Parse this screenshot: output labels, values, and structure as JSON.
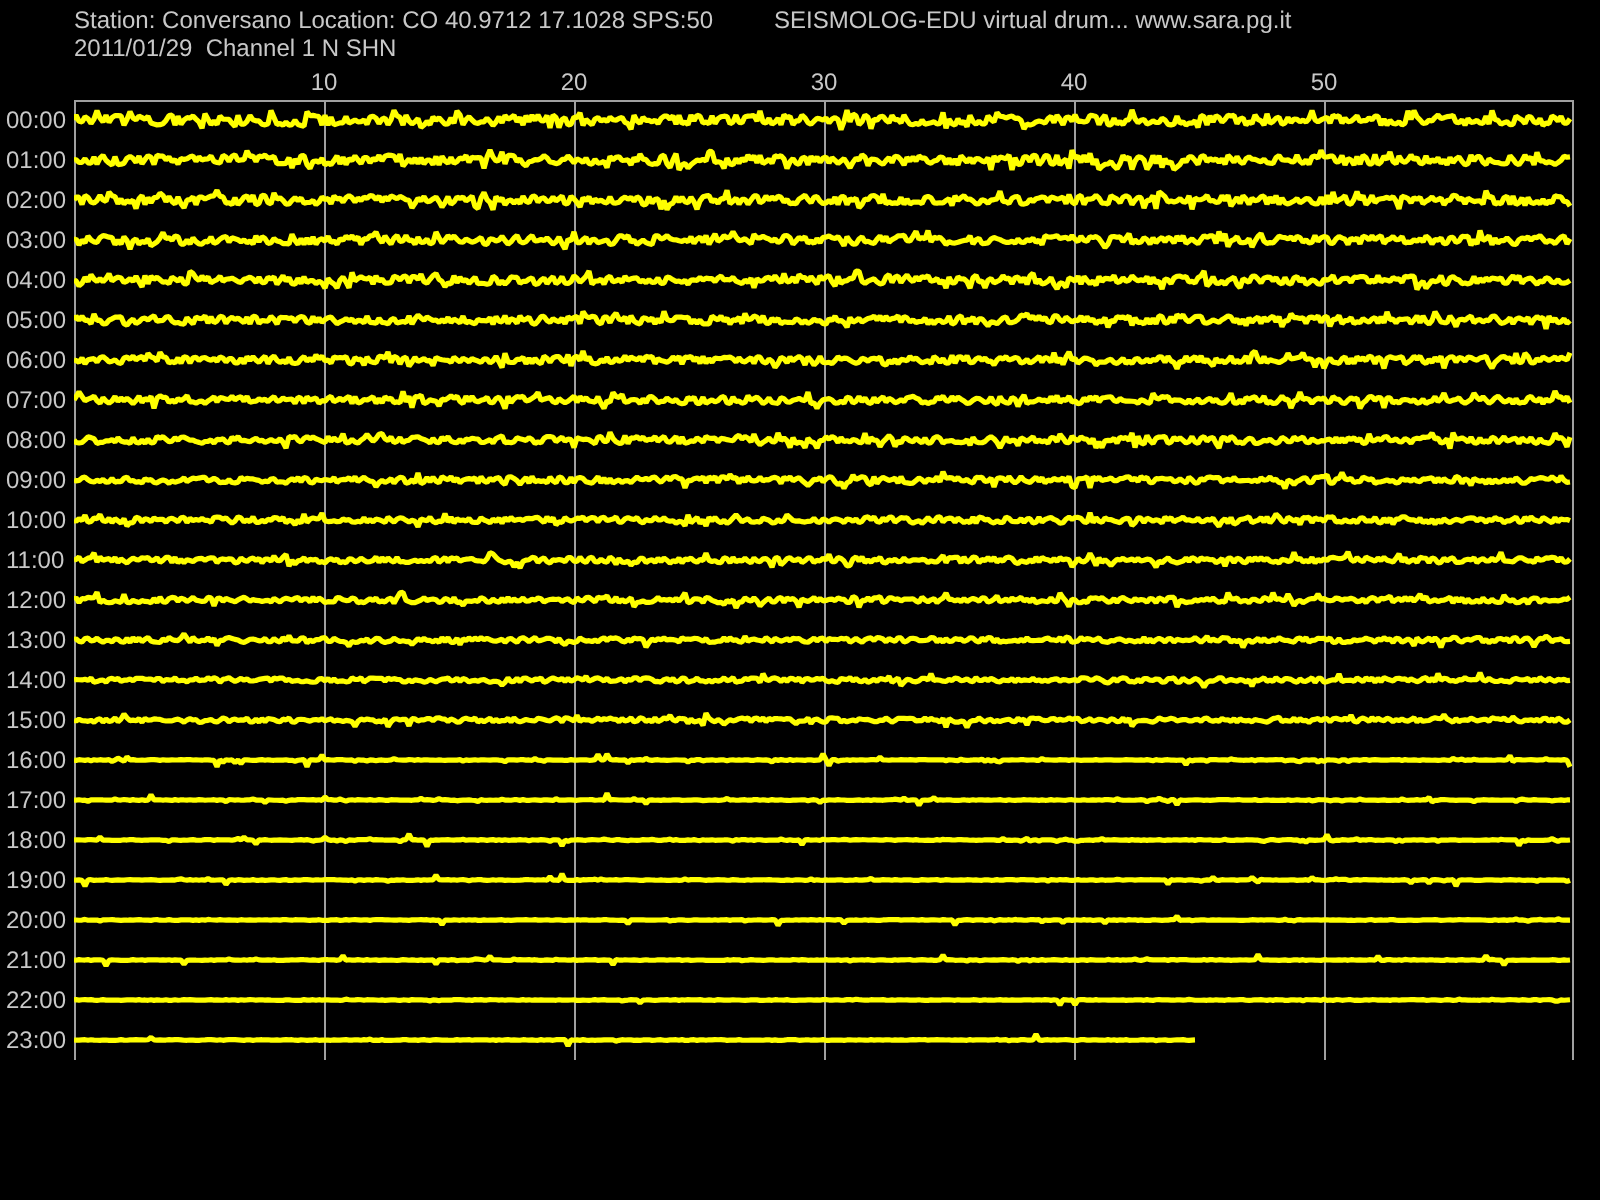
{
  "header": {
    "station": "Station: Conversano Location: CO 40.9712 17.1028 SPS:50",
    "title": "SEISMOLOG-EDU virtual drum... www.sara.pg.it",
    "date_channel": "2011/01/29  Channel 1 N SHN"
  },
  "minute_axis": {
    "ticks": [
      "10",
      "20",
      "30",
      "40",
      "50"
    ]
  },
  "rows": [
    {
      "time": "00:00",
      "level": 1
    },
    {
      "time": "01:00",
      "level": 1
    },
    {
      "time": "02:00",
      "level": 1
    },
    {
      "time": "03:00",
      "level": 1
    },
    {
      "time": "04:00",
      "level": 1
    },
    {
      "time": "05:00",
      "level": 1
    },
    {
      "time": "06:00",
      "level": 1
    },
    {
      "time": "07:00",
      "level": 1
    },
    {
      "time": "08:00",
      "level": 1
    },
    {
      "time": "09:00",
      "level": 1
    },
    {
      "time": "10:00",
      "level": 1
    },
    {
      "time": "11:00",
      "level": 1
    },
    {
      "time": "12:00",
      "level": 1
    },
    {
      "time": "13:00",
      "level": 1
    },
    {
      "time": "14:00",
      "level": 1
    },
    {
      "time": "15:00",
      "level": 1
    },
    {
      "time": "16:00",
      "level": 1
    },
    {
      "time": "17:00",
      "level": 1
    },
    {
      "time": "18:00",
      "level": 1
    },
    {
      "time": "19:00",
      "level": 1
    },
    {
      "time": "20:00",
      "level": 1
    },
    {
      "time": "21:00",
      "level": 1
    },
    {
      "time": "22:00",
      "level": 1
    },
    {
      "time": "23:00",
      "level": 0.75
    }
  ]
}
